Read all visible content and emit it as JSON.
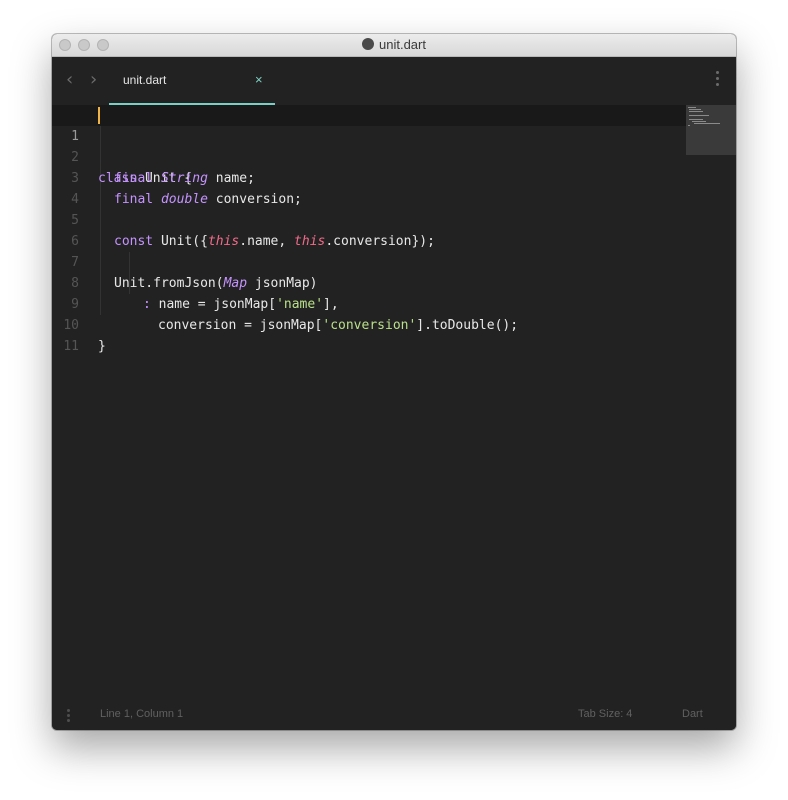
{
  "window": {
    "title": "unit.dart"
  },
  "tab": {
    "label": "unit.dart",
    "close_glyph": "×"
  },
  "nav": {
    "back_glyph": "‹",
    "forward_glyph": "›"
  },
  "editor": {
    "line_numbers": [
      "1",
      "2",
      "3",
      "4",
      "5",
      "6",
      "7",
      "8",
      "9",
      "10",
      "11"
    ],
    "tokens": {
      "l1_kw": "class",
      "l1_rest": " Unit {",
      "l2_kw": "final",
      "l2_ty": "String",
      "l2_rest": " name",
      "l2_semi": ";",
      "l3_kw": "final",
      "l3_ty": "double",
      "l3_rest": " conversion",
      "l3_semi": ";",
      "l5_kw": "const",
      "l5_a": " Unit({",
      "l5_this1": "this",
      "l5_b": ".name, ",
      "l5_this2": "this",
      "l5_c": ".conversion});",
      "l7_a": "Unit.fromJson(",
      "l7_ty": "Map",
      "l7_b": " jsonMap)",
      "l8_colon": ":",
      "l8_a": " name = jsonMap[",
      "l8_str": "'name'",
      "l8_b": "],",
      "l9_a": "conversion = jsonMap[",
      "l9_str": "'conversion'",
      "l9_b": "].toDouble();",
      "l10": "}"
    }
  },
  "status": {
    "position": "Line 1, Column 1",
    "tab_size": "Tab Size: 4",
    "language": "Dart"
  },
  "colors": {
    "background": "#222222",
    "keyword": "#c593ff",
    "this_keyword": "#f26b8a",
    "string": "#b9e08a",
    "accent": "#79cfc4",
    "cursor": "#f0b347"
  }
}
